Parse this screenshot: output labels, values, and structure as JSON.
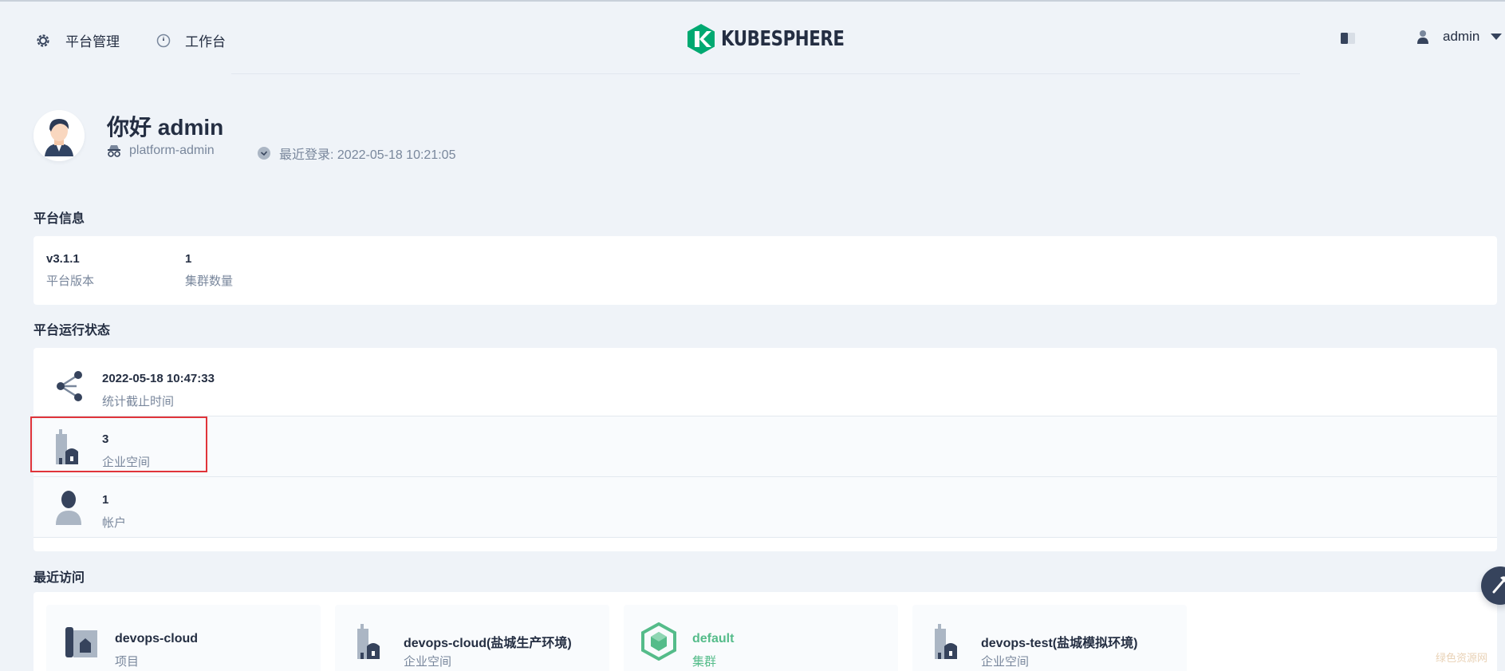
{
  "header": {
    "nav_platform": "平台管理",
    "nav_workbench": "工作台",
    "logo_text": "KUBESPHERE",
    "user_name": "admin"
  },
  "greeting": {
    "title": "你好 admin",
    "role": "platform-admin",
    "last_login": "最近登录: 2022-05-18 10:21:05"
  },
  "platform_info": {
    "title": "平台信息",
    "items": [
      {
        "value": "v3.1.1",
        "label": "平台版本"
      },
      {
        "value": "1",
        "label": "集群数量"
      }
    ]
  },
  "platform_status": {
    "title": "平台运行状态",
    "rows": [
      {
        "value": "2022-05-18 10:47:33",
        "label": "统计截止时间",
        "icon": "share-nodes-icon"
      },
      {
        "value": "3",
        "label": "企业空间",
        "icon": "workspace-icon"
      },
      {
        "value": "1",
        "label": "帐户",
        "icon": "user-icon"
      }
    ]
  },
  "recent": {
    "title": "最近访问",
    "items": [
      {
        "name": "devops-cloud",
        "type": "项目",
        "icon": "project-icon"
      },
      {
        "name": "devops-cloud(盐城生产环境)",
        "type": "企业空间",
        "icon": "workspace-icon"
      },
      {
        "name": "default",
        "type": "集群",
        "icon": "cluster-icon"
      },
      {
        "name": "devops-test(盐城模拟环境)",
        "type": "企业空间",
        "icon": "workspace-icon"
      }
    ]
  },
  "colors": {
    "accent_green": "#55bc8a",
    "dark": "#242e42",
    "muted": "#79879c",
    "highlight_red": "#e0343a",
    "background": "#eff3f8"
  },
  "watermark": "绿色资源网"
}
